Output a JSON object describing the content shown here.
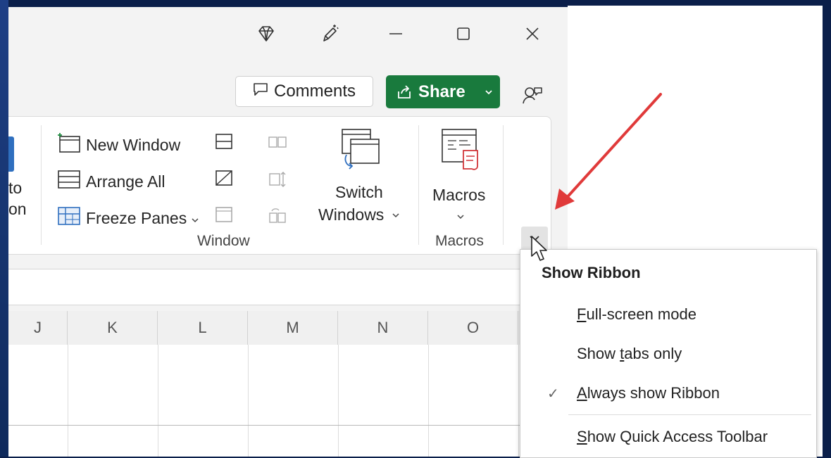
{
  "accent": {
    "share_green": "#197a3d",
    "arrow_red": "#e03a3a",
    "desktop_blue": "#0b1f4a"
  },
  "titlebar": {
    "icons": [
      "diamond-icon",
      "pen-sparkle-icon",
      "minimize-icon",
      "maximize-icon",
      "close-icon"
    ]
  },
  "toolbar": {
    "comments_label": "Comments",
    "share_label": "Share"
  },
  "ribbon": {
    "partial_left_lines": [
      "to",
      "on"
    ],
    "window_group": {
      "new_window": "New Window",
      "arrange_all": "Arrange All",
      "freeze_panes": "Freeze Panes",
      "switch_windows_line1": "Switch",
      "switch_windows_line2": "Windows",
      "label": "Window"
    },
    "macros_group": {
      "macros_button": "Macros",
      "label": "Macros"
    }
  },
  "sheet": {
    "columns": [
      "J",
      "K",
      "L",
      "M",
      "N",
      "O"
    ]
  },
  "ribbon_menu": {
    "title": "Show Ribbon",
    "items": [
      {
        "pre": "",
        "mnemonic": "F",
        "post": "ull-screen mode",
        "checked": false
      },
      {
        "pre": "Show ",
        "mnemonic": "t",
        "post": "abs only",
        "checked": false
      },
      {
        "pre": "",
        "mnemonic": "A",
        "post": "lways show Ribbon",
        "checked": true
      },
      {
        "pre": "",
        "mnemonic": "S",
        "post": "how Quick Access Toolbar",
        "checked": false
      }
    ]
  }
}
